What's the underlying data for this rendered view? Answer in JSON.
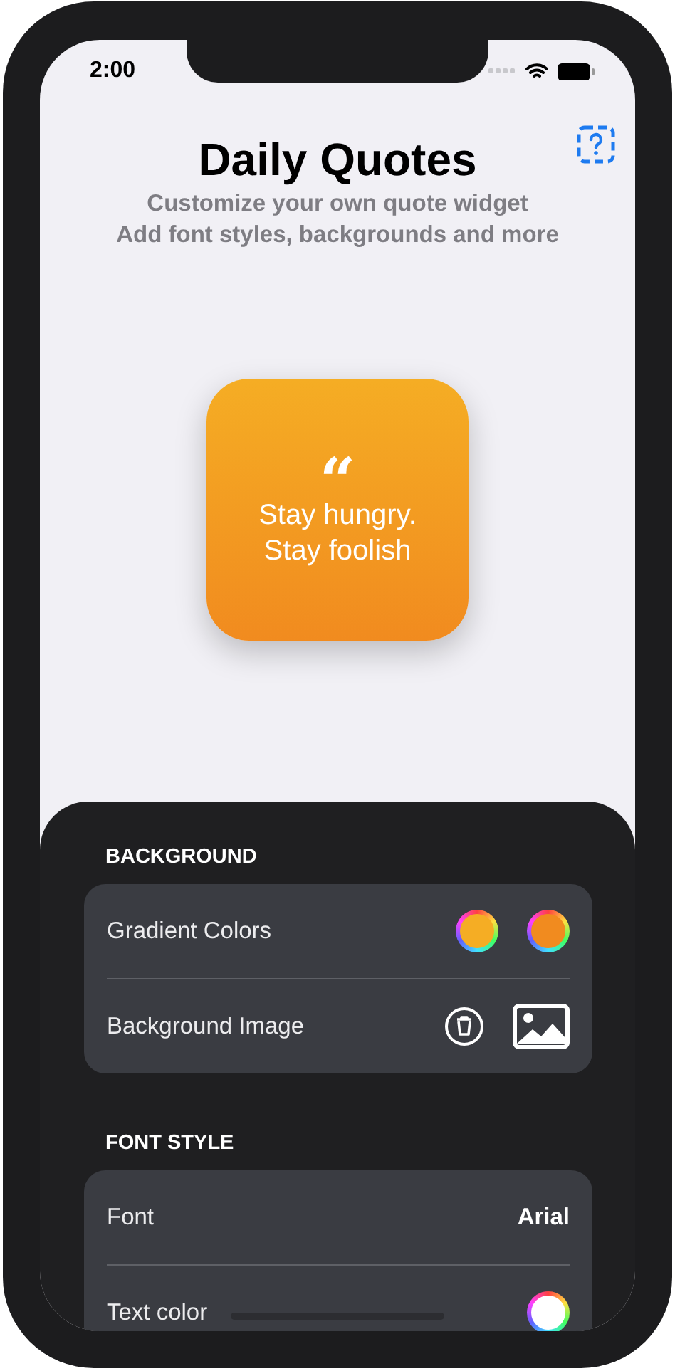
{
  "status_bar": {
    "time": "2:00"
  },
  "header": {
    "title": "Daily Quotes",
    "subtitle": [
      "Customize your own quote widget",
      "Add font styles, backgrounds and more"
    ]
  },
  "widget": {
    "quote_mark": "“",
    "text": "Stay hungry.\nStay foolish"
  },
  "sections": [
    {
      "title": "BACKGROUND",
      "rows": [
        {
          "kind": "colors",
          "label": "Gradient Colors",
          "swatches": [
            {
              "color": "#f5ad24"
            },
            {
              "color": "#f18b1f"
            }
          ]
        },
        {
          "kind": "image",
          "label": "Background Image"
        }
      ]
    },
    {
      "title": "FONT STYLE",
      "rows": [
        {
          "kind": "value",
          "label": "Font",
          "value": "Arial"
        },
        {
          "kind": "colors",
          "label": "Text color",
          "swatches": [
            {
              "color": "#ffffff"
            }
          ]
        }
      ]
    }
  ]
}
